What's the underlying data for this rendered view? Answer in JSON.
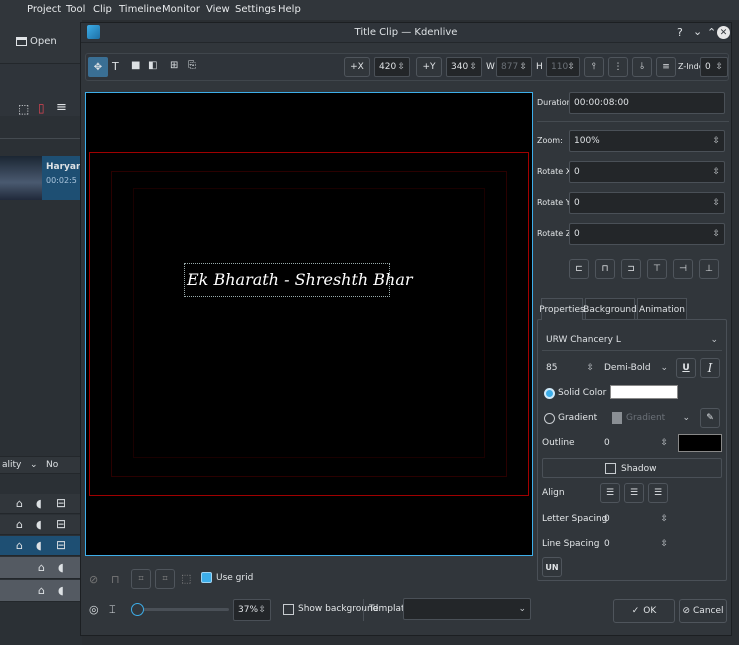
{
  "menubar": {
    "items": [
      "Project",
      "Tool",
      "Clip",
      "Timeline",
      "Monitor",
      "View",
      "Settings",
      "Help"
    ]
  },
  "left_panel": {
    "open_label": "Open",
    "clip_name": "Haryar",
    "clip_time": "00:02:5",
    "quality_label": "ality",
    "track_label": "No"
  },
  "dialog": {
    "title": "Title Clip — Kdenlive",
    "title_controls": [
      "?",
      "⌄",
      "⌃"
    ],
    "toolbar": {
      "x_label": "+X",
      "x_value": "420",
      "y_label": "+Y",
      "y_value": "340",
      "w_label": "W",
      "w_value": "877",
      "h_label": "H",
      "h_value": "110",
      "zindex_label": "Z-Index:",
      "zindex_value": "0"
    },
    "canvas_text": "Ek Bharath  - Shreshth Bhar",
    "properties": {
      "duration_label": "Duration",
      "duration_value": "00:00:08:00",
      "zoom_label": "Zoom:",
      "zoom_value": "100%",
      "rotx_label": "Rotate X:",
      "rotx_value": "0",
      "roty_label": "Rotate Y:",
      "roty_value": "0",
      "rotz_label": "Rotate Z:",
      "rotz_value": "0"
    },
    "tabs": [
      "Properties",
      "Background",
      "Animation"
    ],
    "font": {
      "family": "URW Chancery L",
      "size": "85",
      "weight": "Demi-Bold",
      "underline": "U",
      "italic": "I"
    },
    "solid_color_label": "Solid Color",
    "gradient_label": "Gradient",
    "gradient_value": "Gradient",
    "outline_label": "Outline",
    "outline_value": "0",
    "shadow_label": "Shadow",
    "align_label": "Align",
    "letter_spacing_label": "Letter Spacing",
    "letter_spacing_value": "0",
    "line_spacing_label": "Line Spacing",
    "line_spacing_value": "0",
    "un_label": "UN",
    "bottom": {
      "use_grid_label": "Use grid",
      "zoom_value": "37%",
      "show_background_label": "Show background",
      "template_label": "Template:",
      "template_value": "",
      "ok_label": "OK",
      "cancel_label": "Cancel"
    }
  },
  "colors": {
    "accent": "#3daee9",
    "canvas_bg": "#000000",
    "safe_zone": "#b00000",
    "solid_color": "#ffffff",
    "outline_color": "#000000"
  }
}
